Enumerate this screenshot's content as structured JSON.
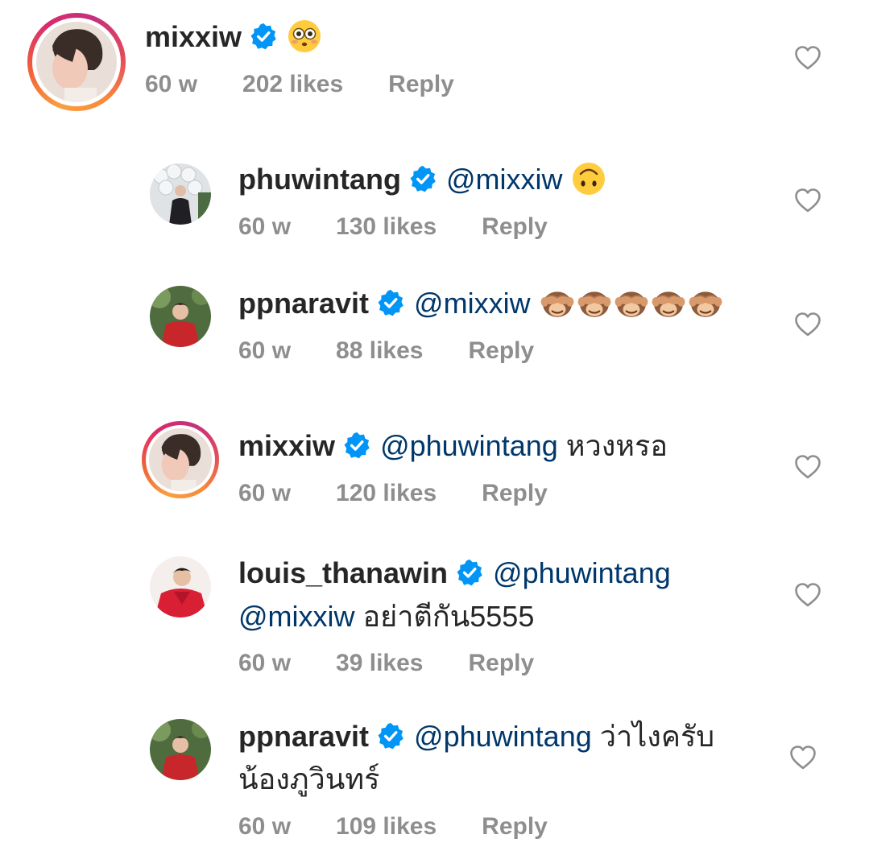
{
  "comments": [
    {
      "username": "mixxiw",
      "mention": "",
      "text": "",
      "emoji": "flushed-face",
      "time": "60 w",
      "likes": "202 likes",
      "reply": "Reply",
      "avatar": "mixxiw-avatar",
      "story_ring": true
    },
    {
      "username": "phuwintang",
      "mention": "@mixxiw",
      "text": "",
      "emoji": "upside-down-face",
      "time": "60 w",
      "likes": "130 likes",
      "reply": "Reply",
      "avatar": "phuwintang-avatar",
      "story_ring": false
    },
    {
      "username": "ppnaravit",
      "mention": "@mixxiw",
      "text": "",
      "emoji": "see-no-evil-monkey x5",
      "time": "60 w",
      "likes": "88 likes",
      "reply": "Reply",
      "avatar": "ppnaravit-avatar",
      "story_ring": false
    },
    {
      "username": "mixxiw",
      "mention": "@phuwintang",
      "text": "หวงหรอ",
      "time": "60 w",
      "likes": "120 likes",
      "reply": "Reply",
      "avatar": "mixxiw-avatar",
      "story_ring": true
    },
    {
      "username": "louis_thanawin",
      "mention": "@phuwintang",
      "mention2": "@mixxiw",
      "text": "อย่าตีกัน5555",
      "time": "60 w",
      "likes": "39 likes",
      "reply": "Reply",
      "avatar": "louis-thanawin-avatar",
      "story_ring": false
    },
    {
      "username": "ppnaravit",
      "mention": "@phuwintang",
      "text": "ว่าไงครับ",
      "text_line2": "น้องภูวินทร์",
      "time": "60 w",
      "likes": "109 likes",
      "reply": "Reply",
      "avatar": "ppnaravit-avatar",
      "story_ring": false
    }
  ],
  "colors": {
    "username": "#262626",
    "mention": "#00376b",
    "meta": "#8e8e8e",
    "verified": "#0095f6",
    "heart_outline": "#8e8e8e"
  },
  "icons": {
    "verified": "verified-badge-icon",
    "like": "heart-outline-icon"
  }
}
